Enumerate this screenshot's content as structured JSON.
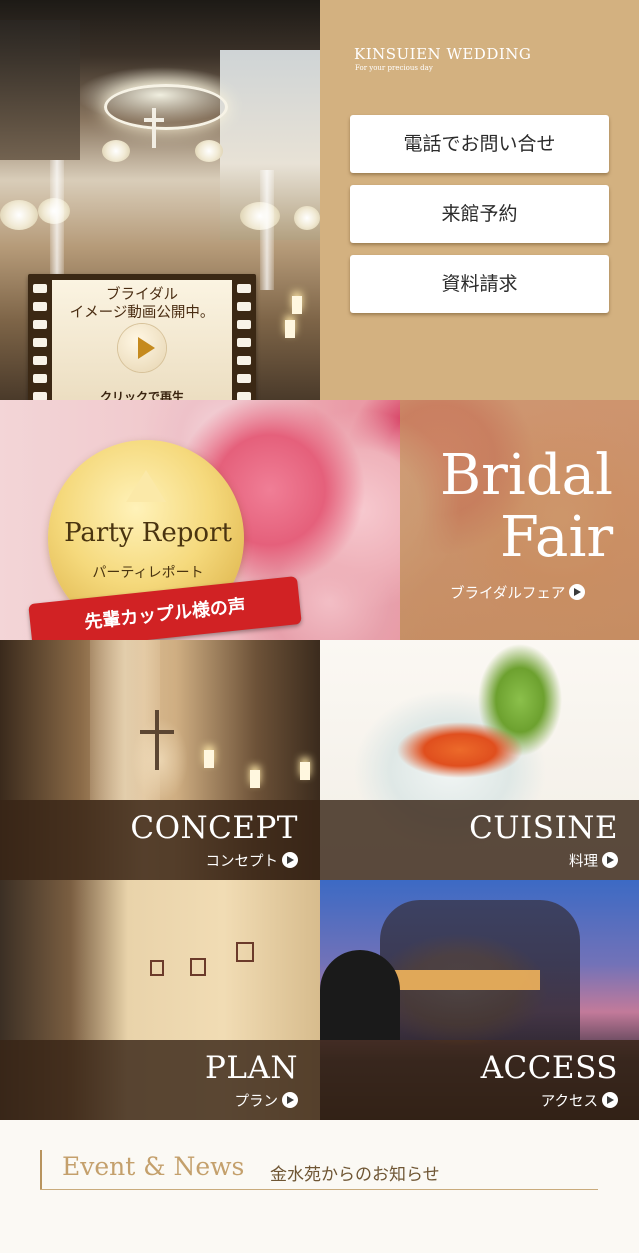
{
  "header": {
    "brand": "KINSUIEN WEDDING",
    "brand_sub": "For your precious day"
  },
  "video": {
    "line1": "ブライダル",
    "line2": "イメージ動画公開中。",
    "cta": "クリックで再生"
  },
  "actions": {
    "phone": "電話でお問い合せ",
    "visit": "来館予約",
    "brochure": "資料請求"
  },
  "party_report": {
    "title": "Party Report",
    "subtitle": "パーティレポート",
    "ribbon": "先輩カップル様の声"
  },
  "bridal_fair": {
    "title_line1": "Bridal",
    "title_line2": "Fair",
    "subtitle": "ブライダルフェア"
  },
  "tiles": {
    "concept": {
      "title": "CONCEPT",
      "subtitle": "コンセプト"
    },
    "cuisine": {
      "title": "CUISINE",
      "subtitle": "料理"
    },
    "plan": {
      "title": "PLAN",
      "subtitle": "プラン"
    },
    "access": {
      "title": "ACCESS",
      "subtitle": "アクセス"
    }
  },
  "news": {
    "title": "Event & News",
    "subtitle": "金水苑からのお知らせ"
  },
  "colors": {
    "accent": "#d3b180",
    "tile_bar": "#38241680",
    "ribbon": "#d12224",
    "news_title": "#c4a06c"
  }
}
